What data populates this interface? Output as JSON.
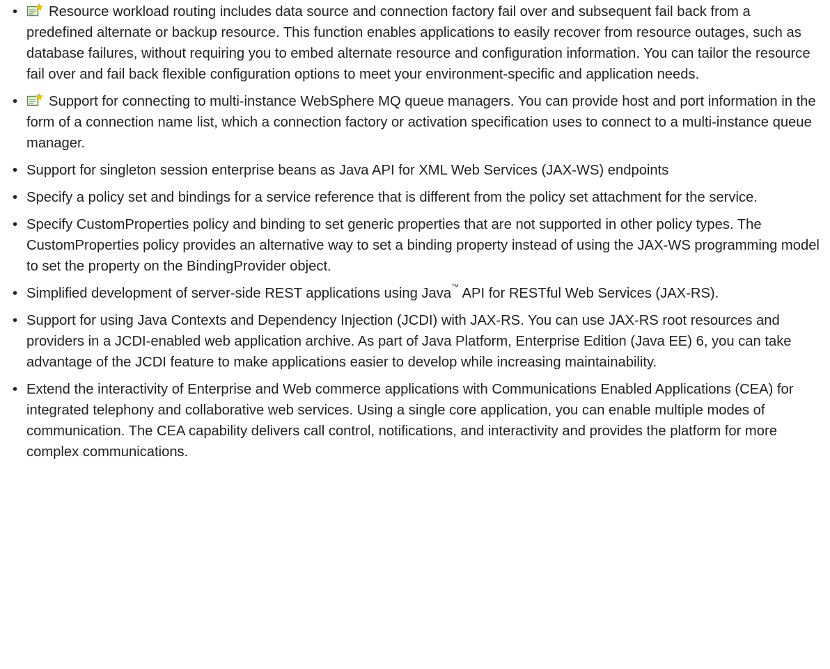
{
  "bullet_char": "•",
  "icons": {
    "new_feature_icon": "new-feature-icon",
    "colors": {
      "page_outline": "#5a8a46",
      "page_fill": "#eaf5df",
      "star": "#f2c200"
    }
  },
  "items": [
    {
      "has_new_icon": true,
      "text": "Resource workload routing includes data source and connection factory fail over and subsequent fail back from a predefined alternate or backup resource. This function enables applications to easily recover from resource outages, such as database failures, without requiring you to embed alternate resource and configuration information. You can tailor the resource fail over and fail back flexible configuration options to meet your environment-specific and application needs."
    },
    {
      "has_new_icon": true,
      "text": "Support for connecting to multi-instance WebSphere MQ queue managers. You can provide host and port information in the form of a connection name list, which a connection factory or activation specification uses to connect to a multi-instance queue manager."
    },
    {
      "has_new_icon": false,
      "text": "Support for singleton session enterprise beans as Java API for XML Web Services (JAX-WS) endpoints"
    },
    {
      "has_new_icon": false,
      "text": "Specify a policy set and bindings for a service reference that is different from the policy set attachment for the service."
    },
    {
      "has_new_icon": false,
      "text": "Specify CustomProperties policy and binding to set generic properties that are not supported in other policy types. The CustomProperties policy provides an alternative way to set a binding property instead of using the JAX-WS programming model to set the property on the BindingProvider object."
    },
    {
      "has_new_icon": false,
      "text_before": "Simplified development of server-side REST applications using Java",
      "tm": "™",
      "text_after": " API for RESTful Web Services (JAX-RS)."
    },
    {
      "has_new_icon": false,
      "text": "Support for using Java Contexts and Dependency Injection (JCDI) with JAX-RS. You can use JAX-RS root resources and providers in a JCDI-enabled web application archive. As part of Java Platform, Enterprise Edition (Java EE) 6, you can take advantage of the JCDI feature to make applications easier to develop while increasing maintainability."
    },
    {
      "has_new_icon": false,
      "text": "Extend the interactivity of Enterprise and Web commerce applications with Communications Enabled Applications (CEA) for integrated telephony and collaborative web services. Using a single core application, you can enable multiple modes of communication. The CEA capability delivers call control, notifications, and interactivity and provides the platform for more complex communications."
    }
  ]
}
